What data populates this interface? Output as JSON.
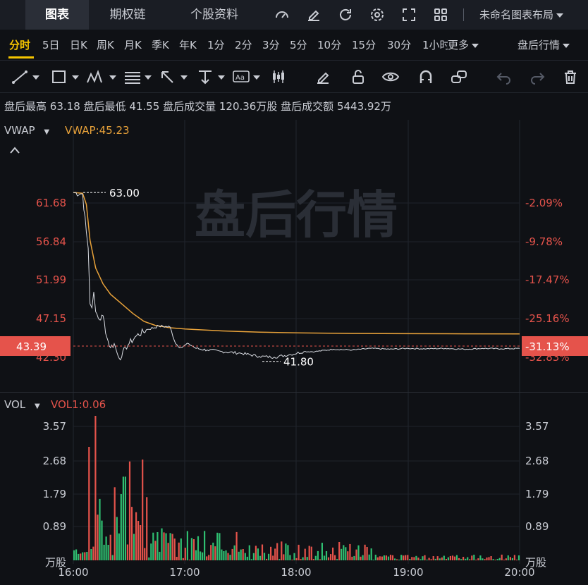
{
  "topbar": {
    "tabs": [
      "图表",
      "期权链",
      "个股资料"
    ],
    "layout_label": "未命名图表布局",
    "icons": [
      "gauge-icon",
      "edit-icon",
      "refresh-icon",
      "settings-icon",
      "fullscreen-icon",
      "grid-layout-icon"
    ]
  },
  "periods": {
    "items": [
      "分时",
      "5日",
      "日K",
      "周K",
      "月K",
      "季K",
      "年K",
      "1分",
      "2分",
      "3分",
      "5分",
      "10分",
      "15分",
      "30分",
      "1小时"
    ],
    "more_label": "更多",
    "active": "分时",
    "session_label": "盘后行情"
  },
  "tools": [
    "trendline-icon",
    "rectangle-icon",
    "pattern-icon",
    "fib-icon",
    "arrow-icon",
    "measure-icon",
    "text-icon",
    "candle-icon",
    "pen-icon",
    "unlock-icon",
    "eye-icon",
    "magnet-icon",
    "link-icon",
    "undo-icon",
    "redo-icon",
    "trash-icon"
  ],
  "info": {
    "high_label": "盘后最高",
    "high_value": "63.18",
    "low_label": "盘后最低",
    "low_value": "41.55",
    "volume_label": "盘后成交量",
    "volume_value": "120.36万股",
    "amount_label": "盘后成交额",
    "amount_value": "5443.92万"
  },
  "price_panel": {
    "indicator": "VWAP",
    "indicator_value": "VWAP:45.23",
    "watermark": "盘后行情",
    "current_price": "43.39",
    "current_pct": "-31.13%",
    "high_marker": "63.00",
    "low_marker": "41.80",
    "hidden_left_label": "42.30",
    "hidden_right_label": "-32.83%",
    "left_labels": [
      "61.68",
      "56.84",
      "51.99",
      "47.15"
    ],
    "right_labels": [
      "-2.09%",
      "-9.78%",
      "-17.47%",
      "-25.16%"
    ]
  },
  "vol_panel": {
    "indicator": "VOL",
    "indicator_value": "VOL1:0.06",
    "labels": [
      "3.57",
      "2.68",
      "1.79",
      "0.89"
    ],
    "unit": "万股"
  },
  "time_axis": [
    "16:00",
    "17:00",
    "18:00",
    "19:00",
    "20:00"
  ],
  "colors": {
    "up": "#2fbf71",
    "down": "#e5534b",
    "vwap": "#e8a23a",
    "price_line": "#d9dce2",
    "accent": "#f5c400"
  },
  "chart_data": {
    "type": "line",
    "x": [
      "16:00",
      "16:05",
      "16:10",
      "16:15",
      "16:20",
      "16:25",
      "16:30",
      "16:40",
      "16:50",
      "17:00",
      "17:20",
      "17:40",
      "18:00",
      "18:30",
      "19:00",
      "19:30",
      "20:00"
    ],
    "series": [
      {
        "name": "VWAP",
        "values": [
          63.0,
          62.5,
          52.0,
          49.5,
          48.0,
          46.8,
          46.2,
          45.9,
          45.7,
          45.6,
          45.45,
          45.35,
          45.3,
          45.25,
          45.24,
          45.23,
          45.23
        ]
      },
      {
        "values": [
          63.0,
          62.8,
          48.5,
          49.0,
          46.5,
          43.5,
          44.5,
          45.2,
          45.8,
          43.8,
          43.3,
          42.0,
          42.6,
          43.2,
          43.4,
          43.3,
          43.39
        ]
      }
    ],
    "ylim": [
      42.3,
      63.18
    ],
    "volume": {
      "unit": "万股",
      "ylim": [
        0,
        3.8
      ],
      "peak": 3.8
    }
  }
}
